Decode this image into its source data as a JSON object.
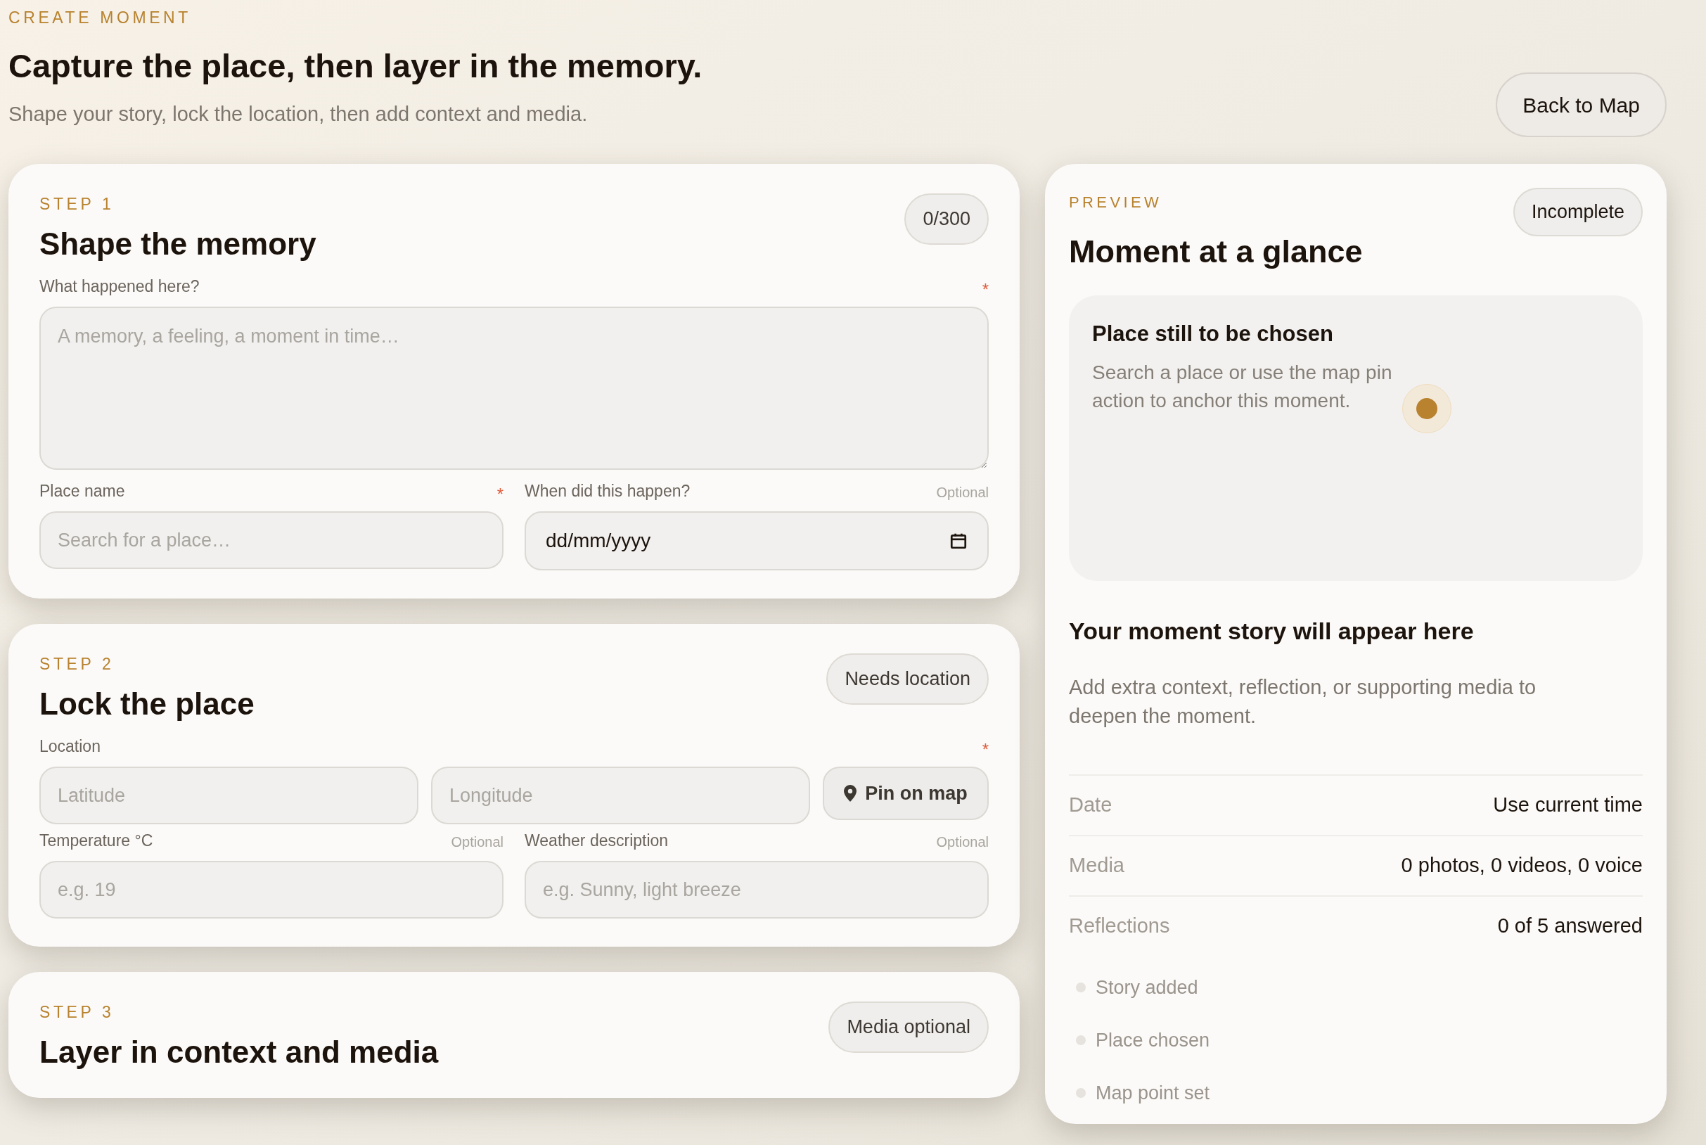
{
  "header": {
    "eyebrow": "CREATE MOMENT",
    "title": "Capture the place, then layer in the memory.",
    "subtitle": "Shape your story, lock the location, then add context and media.",
    "back_button": "Back to Map"
  },
  "steps": [
    {
      "step_label": "STEP 1",
      "title": "Shape the memory",
      "badge": "0/300",
      "rows": [
        {
          "kind": "fields",
          "fields": [
            {
              "kind": "textarea",
              "label": "What happened here?",
              "required": true,
              "required_mark": "*",
              "placeholder": "A memory, a feeling, a moment in time…"
            }
          ]
        },
        {
          "kind": "fields",
          "fields": [
            {
              "kind": "text",
              "label": "Place name",
              "required": true,
              "required_mark": "*",
              "placeholder": "Search for a place…"
            },
            {
              "kind": "date",
              "label": "When did this happen?",
              "required": false,
              "note": "Optional",
              "value": "dd/mm/yyyy"
            }
          ]
        }
      ]
    },
    {
      "step_label": "STEP 2",
      "title": "Lock the place",
      "badge": "Needs location",
      "rows": [
        {
          "kind": "location",
          "label": "Location",
          "required": true,
          "required_mark": "*",
          "latitude_placeholder": "Latitude",
          "longitude_placeholder": "Longitude",
          "pin_button": "Pin on map"
        },
        {
          "kind": "fields",
          "fields": [
            {
              "kind": "text",
              "label": "Temperature °C",
              "required": false,
              "note": "Optional",
              "placeholder": "e.g. 19"
            },
            {
              "kind": "text",
              "label": "Weather description",
              "required": false,
              "note": "Optional",
              "placeholder": "e.g. Sunny, light breeze"
            }
          ]
        }
      ]
    },
    {
      "step_label": "STEP 3",
      "title": "Layer in context and media",
      "badge": "Media optional"
    }
  ],
  "preview": {
    "eyebrow": "PREVIEW",
    "title": "Moment at a glance",
    "status": "Incomplete",
    "map": {
      "title": "Place still to be chosen",
      "text": "Search a place or use the map pin action to anchor this moment."
    },
    "story_title": "Your moment story will appear here",
    "story_text": "Add extra context, reflection, or supporting media to deepen the moment.",
    "details": [
      {
        "label": "Date",
        "value": "Use current time"
      },
      {
        "label": "Media",
        "value": "0 photos, 0 videos, 0 voice"
      },
      {
        "label": "Reflections",
        "value": "0 of 5 answered"
      }
    ],
    "checklist": [
      {
        "label": "Story added",
        "done": false
      },
      {
        "label": "Place chosen",
        "done": false
      },
      {
        "label": "Map point set",
        "done": false
      }
    ]
  }
}
